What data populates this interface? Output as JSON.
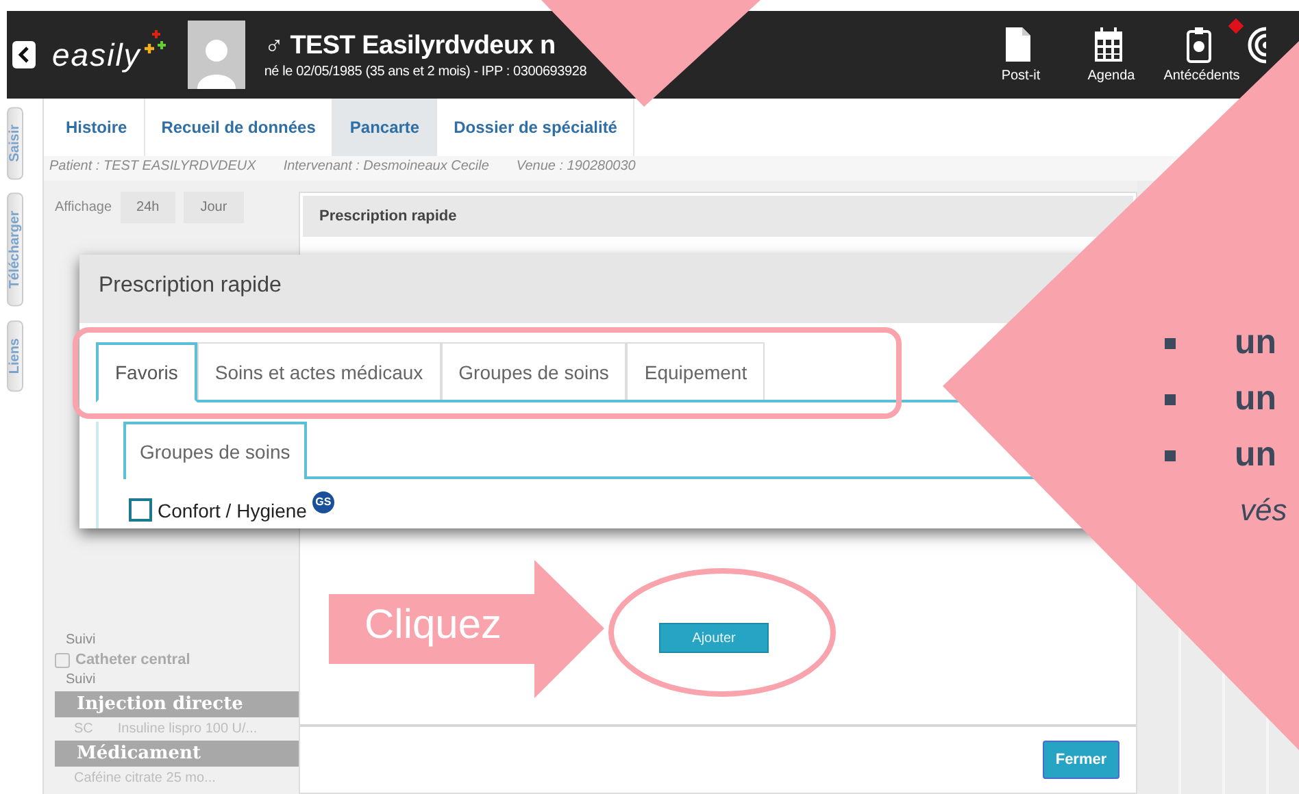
{
  "header": {
    "logo": "easily",
    "gender_symbol": "♂",
    "patient_name": "TEST Easilyrdvdeux n",
    "patient_info": "né le 02/05/1985 (35 ans et 2 mois) - IPP : 0300693928",
    "toolbar": [
      {
        "kind": "note",
        "label": "Post-it",
        "alert": false
      },
      {
        "kind": "calendar",
        "label": "Agenda",
        "alert": false
      },
      {
        "kind": "clipboard",
        "label": "Antécédents",
        "alert": true
      },
      {
        "kind": "target",
        "alert": false
      }
    ]
  },
  "side_tabs": [
    "Saisir",
    "Télécharger",
    "Liens"
  ],
  "tabs": [
    {
      "label": "Histoire",
      "selected": false
    },
    {
      "label": "Recueil de données",
      "selected": false
    },
    {
      "label": "Pancarte",
      "selected": true
    },
    {
      "label": "Dossier de spécialité",
      "selected": false
    }
  ],
  "context_bar": [
    "Patient : TEST EASILYRDVDEUX",
    "Intervenant : Desmoineaux Cecile",
    "Venue : 190280030"
  ],
  "display": {
    "label": "Affichage",
    "buttons": [
      "24h",
      "Jour"
    ]
  },
  "care_list": [
    {
      "kind": "sub",
      "text": "Suivi"
    },
    {
      "kind": "title",
      "text": "Catheter central",
      "checked": false
    },
    {
      "kind": "sub",
      "text": "Suivi"
    },
    {
      "kind": "group",
      "text": "Injection directe"
    },
    {
      "kind": "row",
      "route": "SC",
      "text": "Insuline lispro 100 U/..."
    },
    {
      "kind": "group",
      "text": "Médicament"
    },
    {
      "kind": "row",
      "text": "Caféine citrate 25 mo..."
    }
  ],
  "back_dialog": {
    "title": "Prescription rapide",
    "add_button": "Ajouter",
    "close_button": "Fermer"
  },
  "popup": {
    "title": "Prescription rapide",
    "tabs": [
      {
        "label": "Favoris",
        "selected": true
      },
      {
        "label": "Soins et actes médicaux",
        "selected": false
      },
      {
        "label": "Groupes de soins",
        "selected": false
      },
      {
        "label": "Equipement",
        "selected": false
      }
    ],
    "subtabs": [
      {
        "label": "Groupes de soins",
        "selected": true
      }
    ],
    "items": [
      {
        "label": "Confort / Hygiene",
        "badge": "GS",
        "checked": false
      }
    ]
  },
  "annotations": {
    "click_label": "Cliquez",
    "bullets": [
      "un",
      "un",
      "un"
    ],
    "note": "vés"
  }
}
